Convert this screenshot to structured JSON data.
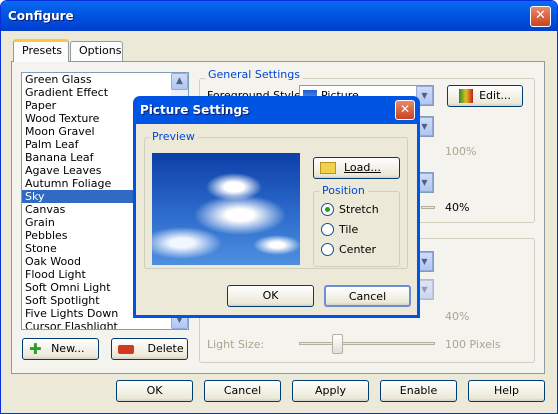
{
  "window": {
    "title": "Configure",
    "close_glyph": "✕"
  },
  "tabs": [
    {
      "label": "Presets"
    },
    {
      "label": "Options"
    }
  ],
  "presets": {
    "items": [
      "Green Glass",
      "Gradient Effect",
      "Paper",
      "Wood Texture",
      "Moon Gravel",
      "Palm Leaf",
      "Banana Leaf",
      "Agave Leaves",
      "Autumn Foliage",
      "Sky",
      "Canvas",
      "Grain",
      "Pebbles",
      "Stone",
      "Oak Wood",
      "Flood Light",
      "Soft Omni Light",
      "Soft Spotlight",
      "Five Lights Down",
      "Cursor Flashlight"
    ],
    "selected": "Sky",
    "new_label": "New...",
    "delete_label": "Delete"
  },
  "general": {
    "group_label": "General Settings",
    "fg_style_label": "Foreground Style:",
    "fg_style_value": "Picture",
    "edit_label": "Edit...",
    "pct1": "100%",
    "pct2": "40%",
    "pct3": "40%",
    "light_size_label": "Light Size:",
    "light_size_value": "100 Pixels"
  },
  "footer": {
    "ok": "OK",
    "cancel": "Cancel",
    "apply": "Apply",
    "enable": "Enable",
    "help": "Help"
  },
  "dialog": {
    "title": "Picture Settings",
    "close_glyph": "✕",
    "preview_label": "Preview",
    "load_label": "Load...",
    "position_label": "Position",
    "options": [
      "Stretch",
      "Tile",
      "Center"
    ],
    "selected": "Stretch",
    "ok": "OK",
    "cancel": "Cancel"
  },
  "colors": {
    "titlebar": "#0054e3",
    "selection": "#316ac5",
    "group_label": "#0046d5"
  }
}
